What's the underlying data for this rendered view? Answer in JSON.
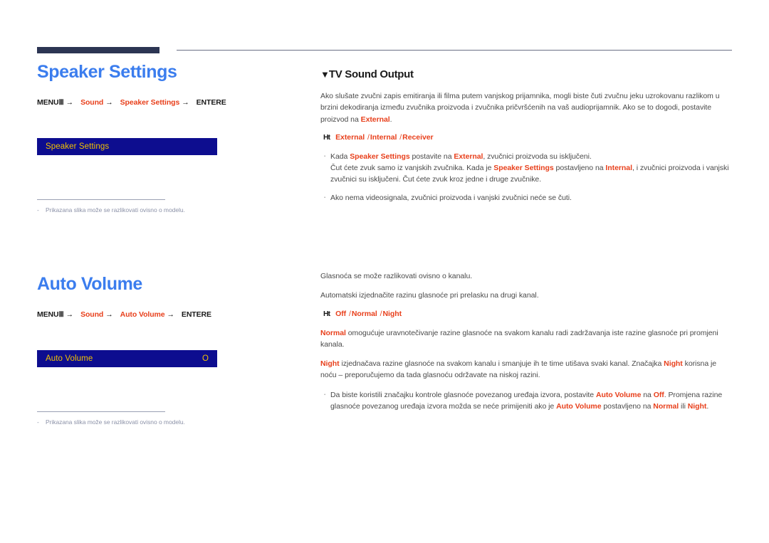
{
  "page": {
    "language": "hr",
    "colors": {
      "heading_blue": "#3b7dee",
      "accent_red": "#e8401c",
      "osd_bg": "#0d0d8f",
      "osd_text": "#f2c200",
      "rule_dark": "#2c3553",
      "footnote_gray": "#8c92a8"
    }
  },
  "sections": [
    {
      "id": "speaker-settings",
      "title": "Speaker Settings",
      "path": {
        "menu_label": "MENU",
        "menu_glyph": "Ⅲ",
        "arrow": "→",
        "steps": [
          "Sound",
          "Speaker Settings"
        ],
        "enter_label": "ENTER",
        "enter_glyph": "E"
      },
      "osd": {
        "label": "Speaker Settings",
        "value": ""
      },
      "footnote": {
        "dash": "-",
        "text": "Prikazana slika može se razlikovati ovisno o modelu."
      },
      "right": {
        "subtitle_glyph": "▼",
        "subtitle": "TV Sound Output",
        "intro": "Ako slušate zvučni zapis emitiranja ili filma putem vanjskog prijamnika, mogli biste čuti zvučnu jeku uzrokovanu razlikom u brzini dekodiranja između zvučnika proizvoda i zvučnika pričvršćenih na vaš audioprijamnik. Ako se to dogodi, postavite proizvod na ",
        "intro_hl": "External",
        "intro_tail": ".",
        "options_bullet": "Ht",
        "options": [
          "External",
          "Internal",
          "Receiver"
        ],
        "bullets": [
          {
            "parts": [
              {
                "t": "Kada ",
                "hl": false
              },
              {
                "t": "Speaker Settings",
                "hl": true
              },
              {
                "t": " postavite na ",
                "hl": false
              },
              {
                "t": "External",
                "hl": true
              },
              {
                "t": ", zvučnici proizvoda su isključeni.",
                "hl": false
              }
            ]
          },
          {
            "continuation": true,
            "parts": [
              {
                "t": "Čut ćete zvuk samo iz vanjskih zvučnika. Kada je ",
                "hl": false
              },
              {
                "t": "Speaker Settings",
                "hl": true
              },
              {
                "t": " postavljeno na ",
                "hl": false
              },
              {
                "t": "Internal",
                "hl": true
              },
              {
                "t": ", i zvučnici proizvoda i vanjski zvučnici su isključeni. Čut ćete zvuk kroz jedne i druge zvučnike.",
                "hl": false
              }
            ]
          },
          {
            "parts": [
              {
                "t": "Ako nema videosignala, zvučnici proizvoda i vanjski zvučnici neće se čuti.",
                "hl": false
              }
            ]
          }
        ]
      }
    },
    {
      "id": "auto-volume",
      "title": "Auto Volume",
      "path": {
        "menu_label": "MENU",
        "menu_glyph": "Ⅲ",
        "arrow": "→",
        "steps": [
          "Sound",
          "Auto Volume"
        ],
        "enter_label": "ENTER",
        "enter_glyph": "E"
      },
      "osd": {
        "label": "Auto Volume",
        "value": "O"
      },
      "footnote": {
        "dash": "-",
        "text": "Prikazana slika može se razlikovati ovisno o modelu."
      },
      "right": {
        "line1": "Glasnoća se može razlikovati ovisno o kanalu.",
        "line2": "Automatski izjednačite razinu glasnoće pri prelasku na drugi kanal.",
        "options_bullet": "Ht",
        "options": [
          "Off",
          "Normal",
          "Night"
        ],
        "paras": [
          {
            "parts": [
              {
                "t": "Normal",
                "hl": true
              },
              {
                "t": " omogućuje uravnotečivanje razine glasnoće na svakom kanalu radi zadržavanja iste razine glasnoće pri promjeni kanala.",
                "hl": false
              }
            ]
          },
          {
            "parts": [
              {
                "t": "Night",
                "hl": true
              },
              {
                "t": " izjednačava razine glasnoće na svakom kanalu i smanjuje ih te time utišava svaki kanal. Značajka ",
                "hl": false
              },
              {
                "t": "Night",
                "hl": true
              },
              {
                "t": " korisna je noću – preporučujemo da tada glasnoću održavate na niskoj razini.",
                "hl": false
              }
            ]
          }
        ],
        "bullets": [
          {
            "parts": [
              {
                "t": "Da biste koristili značajku kontrole glasnoće povezanog uređaja izvora, postavite ",
                "hl": false
              },
              {
                "t": "Auto Volume",
                "hl": true
              },
              {
                "t": " na ",
                "hl": false
              },
              {
                "t": "Off",
                "hl": true
              },
              {
                "t": ". Promjena razine glasnoće povezanog uređaja izvora možda se neće primijeniti ako je ",
                "hl": false
              },
              {
                "t": "Auto Volume",
                "hl": true
              },
              {
                "t": " postavljeno na ",
                "hl": false
              },
              {
                "t": "Normal",
                "hl": true
              },
              {
                "t": " ili ",
                "hl": false
              },
              {
                "t": "Night",
                "hl": true
              },
              {
                "t": ".",
                "hl": false
              }
            ]
          }
        ]
      }
    }
  ]
}
